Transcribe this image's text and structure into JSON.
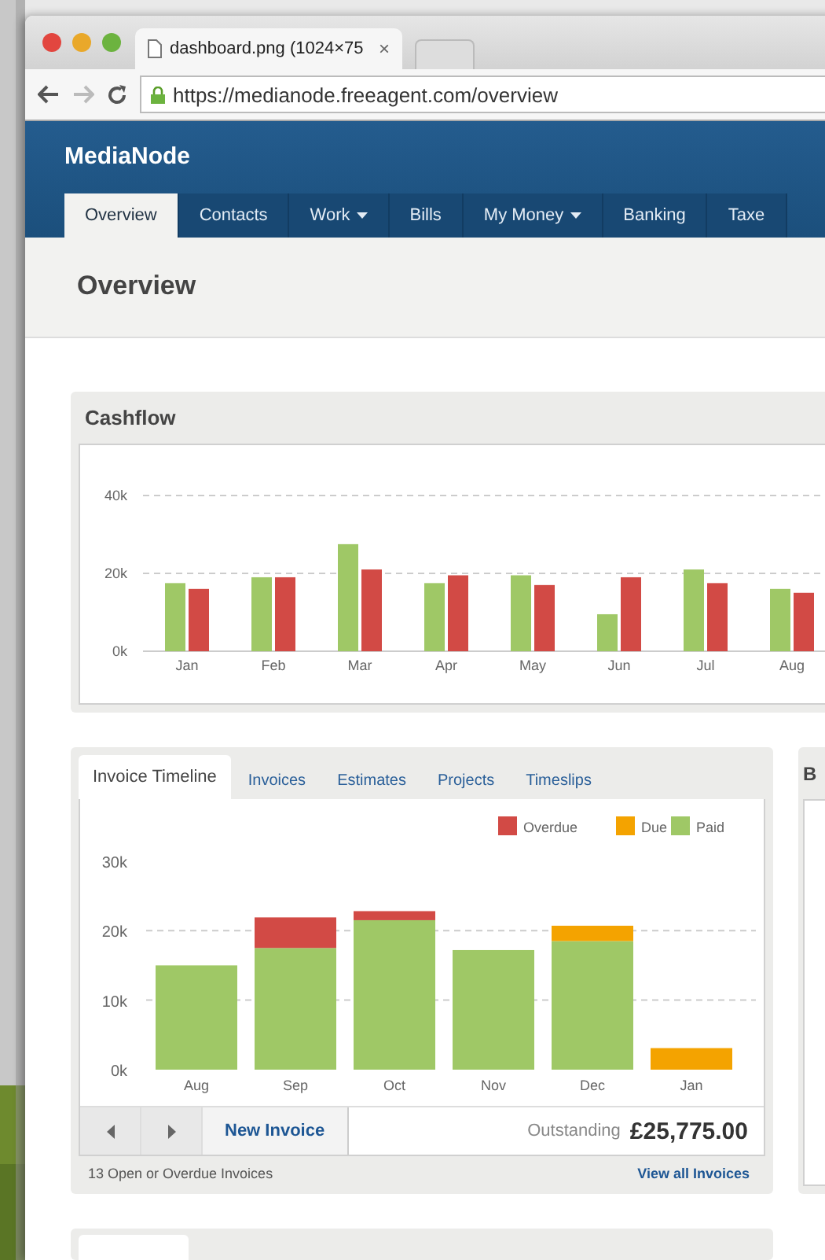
{
  "browser": {
    "tab": {
      "title": "dashboard.png (1024×75",
      "close": "×"
    },
    "url": "https://medianode.freeagent.com/overview"
  },
  "header": {
    "brand": "MediaNode",
    "nav": [
      {
        "label": "Overview",
        "selected": true,
        "dropdown": false
      },
      {
        "label": "Contacts",
        "selected": false,
        "dropdown": false
      },
      {
        "label": "Work",
        "selected": false,
        "dropdown": true
      },
      {
        "label": "Bills",
        "selected": false,
        "dropdown": false
      },
      {
        "label": "My Money",
        "selected": false,
        "dropdown": true
      },
      {
        "label": "Banking",
        "selected": false,
        "dropdown": false
      },
      {
        "label": "Taxe",
        "selected": false,
        "dropdown": false
      }
    ]
  },
  "page_title": "Overview",
  "cashflow": {
    "title": "Cashflow",
    "chart_data": {
      "type": "bar",
      "categories": [
        "Jan",
        "Feb",
        "Mar",
        "Apr",
        "May",
        "Jun",
        "Jul",
        "Aug"
      ],
      "ylim": [
        0,
        40
      ],
      "yticks": [
        {
          "value": 0,
          "label": "0k"
        },
        {
          "value": 20,
          "label": "20k"
        },
        {
          "value": 40,
          "label": "40k"
        }
      ],
      "series": [
        {
          "color": "#9fc866",
          "values": [
            17.5,
            19,
            27.5,
            17.5,
            19.5,
            9.5,
            21,
            16
          ]
        },
        {
          "color": "#d24a45",
          "values": [
            16,
            19,
            21,
            19.5,
            17,
            19,
            17.5,
            15
          ]
        }
      ]
    }
  },
  "invoices": {
    "tabs": [
      {
        "label": "Invoice Timeline",
        "selected": true
      },
      {
        "label": "Invoices",
        "selected": false
      },
      {
        "label": "Estimates",
        "selected": false
      },
      {
        "label": "Projects",
        "selected": false
      },
      {
        "label": "Timeslips",
        "selected": false
      }
    ],
    "chart_data": {
      "type": "bar",
      "stacked": true,
      "legend": "top-right",
      "categories": [
        "Aug",
        "Sep",
        "Oct",
        "Nov",
        "Dec",
        "Jan"
      ],
      "ylim": [
        0,
        30
      ],
      "yticks": [
        {
          "value": 0,
          "label": "0k"
        },
        {
          "value": 10,
          "label": "10k"
        },
        {
          "value": 20,
          "label": "20k"
        },
        {
          "value": 30,
          "label": "30k"
        }
      ],
      "series": [
        {
          "name": "Paid",
          "color": "#9fc866",
          "values": [
            15,
            17.5,
            21.5,
            17.2,
            18.5,
            0
          ]
        },
        {
          "name": "Due",
          "color": "#f4a300",
          "values": [
            0,
            0,
            0,
            0,
            2.2,
            3.1
          ]
        },
        {
          "name": "Overdue",
          "color": "#d24a45",
          "values": [
            0,
            4.4,
            1.3,
            0,
            0,
            0
          ]
        }
      ]
    },
    "new_button": "New Invoice",
    "outstanding_label": "Outstanding",
    "outstanding_value": "£25,775.00",
    "open_count": "13 Open or Overdue Invoices",
    "view_all": "View all Invoices"
  },
  "side_panel": {
    "title": "B"
  }
}
